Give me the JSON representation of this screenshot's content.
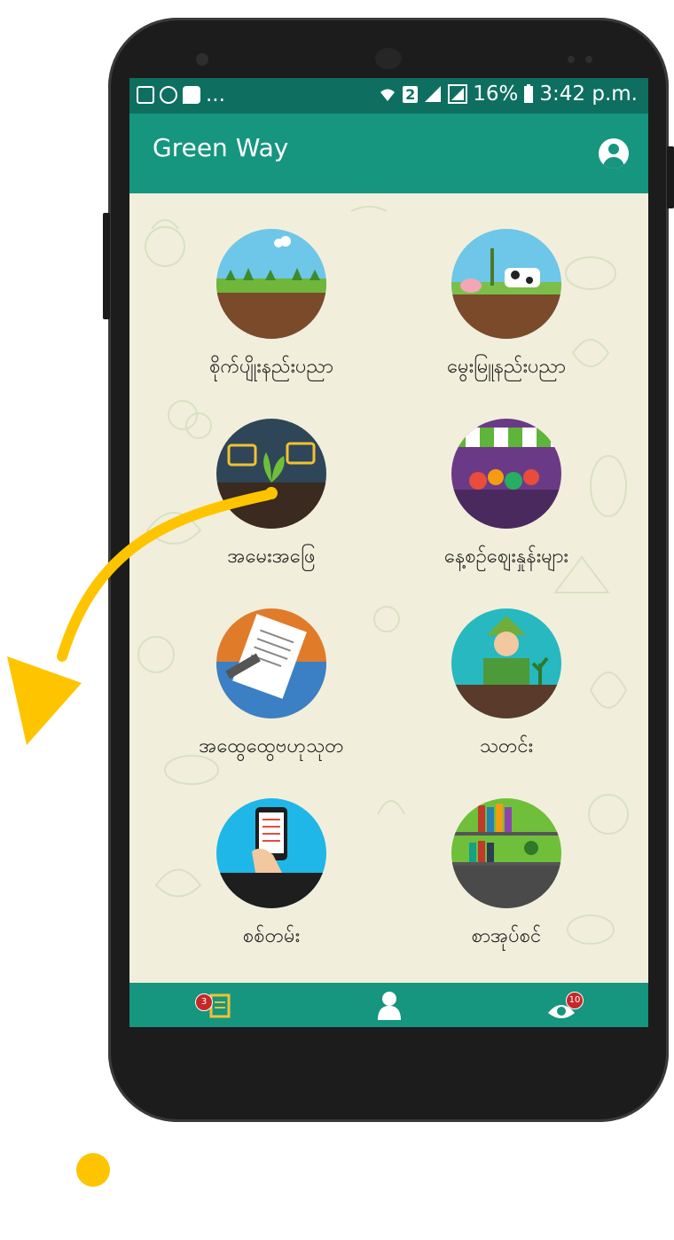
{
  "status_bar": {
    "left_icons": [
      "gmail-icon",
      "sync-icon",
      "chat-icon"
    ],
    "left_more": "...",
    "sim_slot": "2",
    "battery": "16%",
    "time": "3:42 p.m."
  },
  "app_bar": {
    "title": "Green Way",
    "account_icon": "account-circle-icon"
  },
  "menu": [
    {
      "label": "စိုက်ပျိုးနည်းပညာ",
      "icon": "crop-farming-icon"
    },
    {
      "label": "မွေးမြူနည်းပညာ",
      "icon": "livestock-icon"
    },
    {
      "label": "အမေးအဖြေ",
      "icon": "qa-plant-icon"
    },
    {
      "label": "နေ့စဉ်ဈေးနှုန်းများ",
      "icon": "market-stall-icon"
    },
    {
      "label": "အထွေထွေဗဟုသုတ",
      "icon": "writing-document-icon"
    },
    {
      "label": "သတင်း",
      "icon": "newspaper-reader-icon"
    },
    {
      "label": "စစ်တမ်း",
      "icon": "survey-phone-icon"
    },
    {
      "label": "စာအုပ်စင်",
      "icon": "bookshelf-icon"
    }
  ],
  "bottom_nav": [
    {
      "icon": "notes-icon",
      "badge": "3"
    },
    {
      "icon": "profile-icon",
      "badge": ""
    },
    {
      "icon": "notification-eye-icon",
      "badge": "10"
    }
  ],
  "colors": {
    "primary": "#16957f",
    "primary_dark": "#0e6f61",
    "background": "#f1efdc",
    "arrow": "#ffc400",
    "badge": "#c62828"
  }
}
